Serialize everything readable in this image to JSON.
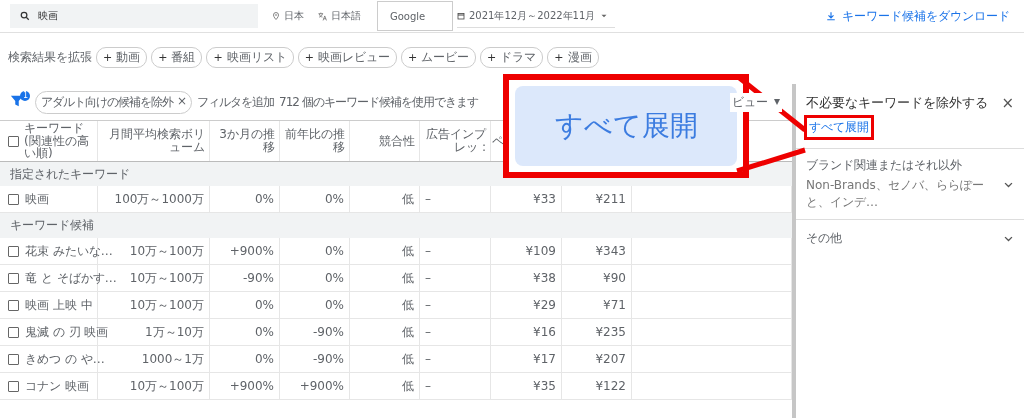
{
  "top_bar": {
    "search": {
      "value": "映画"
    },
    "location": "日本",
    "language": "日本語",
    "network": "Google",
    "date_range": "2021年12月～2022年11月",
    "download": "キーワード候補をダウンロード"
  },
  "broaden": {
    "label": "検索結果を拡張",
    "chips": [
      {
        "plus": "+",
        "label": "動画"
      },
      {
        "plus": "+",
        "label": "番組"
      },
      {
        "plus": "+",
        "label": "映画リスト"
      },
      {
        "plus": "+",
        "label": "映画レビュー"
      },
      {
        "plus": "+",
        "label": "ムービー"
      },
      {
        "plus": "+",
        "label": "ドラマ"
      },
      {
        "plus": "+",
        "label": "漫画"
      }
    ]
  },
  "filter_bar": {
    "badge": "1",
    "filter_chip": "アダルト向けの候補を除外",
    "chip_close": "×",
    "add_filter": "フィルタを追加",
    "count": "712 個のキーワード候補を使用できます",
    "view": "ビュー",
    "view_caret": "▾"
  },
  "table": {
    "select_all_checked": false,
    "columns": [
      "キーワード (関連性の高い順)",
      "月間平均検索ボリューム",
      "3か月の推移",
      "前年比の推移",
      "競合性",
      "広告インプレッ :",
      "ペ"
    ],
    "groups": [
      {
        "title": "指定されたキーワード",
        "rows": [
          {
            "checked": false,
            "cells": [
              "映画",
              "100万～1000万",
              "0%",
              "0%",
              "低",
              "–",
              "¥33",
              "¥211"
            ]
          }
        ]
      },
      {
        "title": "キーワード候補",
        "rows": [
          {
            "checked": false,
            "cells": [
              "花束 みたいな…",
              "10万～100万",
              "+900%",
              "0%",
              "低",
              "–",
              "¥109",
              "¥343"
            ]
          },
          {
            "checked": false,
            "cells": [
              "竜 と そばかす…",
              "10万～100万",
              "-90%",
              "0%",
              "低",
              "–",
              "¥38",
              "¥90"
            ]
          },
          {
            "checked": false,
            "cells": [
              "映画 上映 中",
              "10万～100万",
              "0%",
              "0%",
              "低",
              "–",
              "¥29",
              "¥71"
            ]
          },
          {
            "checked": false,
            "cells": [
              "鬼滅 の 刃 映画",
              "1万～10万",
              "0%",
              "-90%",
              "低",
              "–",
              "¥16",
              "¥235"
            ]
          },
          {
            "checked": false,
            "cells": [
              "きめつ の や…",
              "1000～1万",
              "0%",
              "-90%",
              "低",
              "–",
              "¥17",
              "¥207"
            ]
          },
          {
            "checked": false,
            "cells": [
              "コナン 映画",
              "10万～100万",
              "+900%",
              "+900%",
              "低",
              "–",
              "¥35",
              "¥122"
            ]
          }
        ]
      }
    ]
  },
  "panel": {
    "title": "不必要なキーワードを除外する",
    "close": "×",
    "expand_all": "すべて展開",
    "sections": [
      {
        "title": "ブランド関連またはそれ以外",
        "subtitle": "Non-Brands、セノバ、ららぽーと、インデ…",
        "expanded": false
      },
      {
        "title": "その他",
        "expanded": false
      }
    ]
  },
  "callout": {
    "text": "すべて展開"
  }
}
